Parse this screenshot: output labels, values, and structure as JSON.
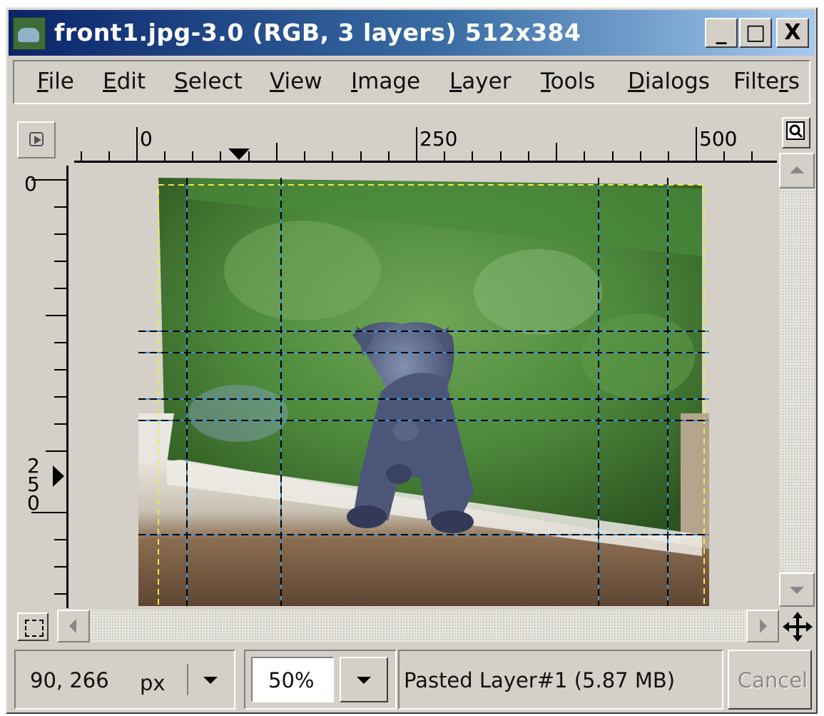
{
  "window": {
    "title": "front1.jpg-3.0 (RGB, 3 layers) 512x384",
    "minimize_symbol": "_",
    "maximize_symbol": "□",
    "close_symbol": "X"
  },
  "menu": [
    {
      "label": "File",
      "key": "F",
      "rest": "ile"
    },
    {
      "label": "Edit",
      "key": "E",
      "rest": "dit"
    },
    {
      "label": "Select",
      "key": "S",
      "rest": "elect"
    },
    {
      "label": "View",
      "key": "V",
      "rest": "iew"
    },
    {
      "label": "Image",
      "key": "I",
      "rest": "mage"
    },
    {
      "label": "Layer",
      "key": "L",
      "rest": "ayer"
    },
    {
      "label": "Tools",
      "key": "T",
      "rest": "ools"
    },
    {
      "label": "Dialogs",
      "key": "D",
      "rest": "ialogs"
    },
    {
      "label": "Filters",
      "pre": "Filte",
      "key": "r",
      "rest": "s"
    }
  ],
  "rulers": {
    "horizontal_labels": [
      "0",
      "250",
      "500"
    ],
    "vertical_labels": [
      "0",
      "250"
    ]
  },
  "status": {
    "coordinates": "90, 266",
    "unit": "px",
    "zoom": "50%",
    "layer_info": "Pasted Layer#1 (5.87 MB)",
    "cancel_label": "Cancel"
  },
  "icons": {
    "window": "gimp-wilber-icon",
    "navigate": "navigate-icon",
    "zoom": "zoom-icon",
    "quick_mask": "quick-mask-icon",
    "pan": "pan-icon"
  },
  "colors": {
    "titlebar_start": "#0a246a",
    "titlebar_end": "#a6caf0",
    "chrome": "#d4d0c8",
    "guide_black": "#000000",
    "guide_blue": "#3b8fe0",
    "layer_boundary": "#f2e84a"
  }
}
